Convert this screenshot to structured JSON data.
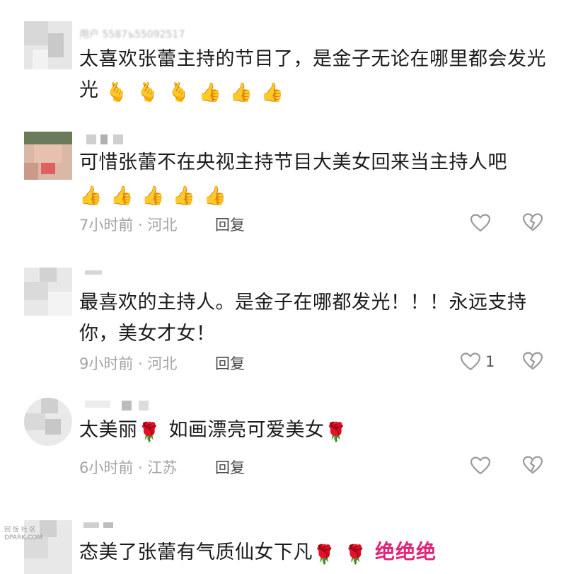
{
  "comments": [
    {
      "username": "用户 5587ъ55092517",
      "text": "太喜欢张蕾主持的节目了，是金子无论在哪里都会发光",
      "emojis": [
        "🫰",
        "🫰",
        "🫰",
        "👍",
        "👍",
        "👍"
      ]
    },
    {
      "text": "可惜张蕾不在央视主持节目大美女回来当主持人吧",
      "emojis": [
        "👍",
        "👍",
        "👍",
        "👍",
        "👍"
      ],
      "meta": "7小时前 · 河北",
      "reply": "回复"
    },
    {
      "text": "最喜欢的主持人。是金子在哪都发光！！！永远支持你，美女才女！",
      "meta": "9小时前 · 河北",
      "reply": "回复",
      "like_count": "1"
    },
    {
      "text_a": "太美丽",
      "text_b": "如画漂亮可爱美女",
      "emoji": "🌹",
      "meta": "6小时前 · 江苏",
      "reply": "回复"
    },
    {
      "text": "态美了张蕾有气质仙女下凡",
      "emoji": "🌹",
      "highlight": "绝绝绝"
    }
  ],
  "icons": {
    "like": "heart-outline-icon",
    "dislike": "broken-heart-icon"
  },
  "watermark": [
    "回 饭 社 区",
    "DPARK.COM"
  ],
  "colors": {
    "meta": "#a3a3a3",
    "highlight": "#e0247a"
  }
}
